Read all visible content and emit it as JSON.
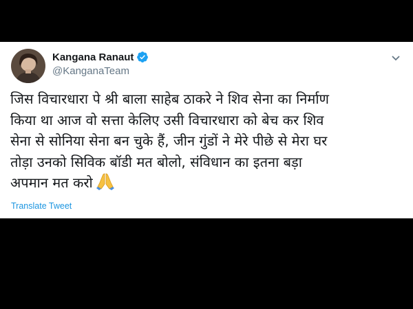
{
  "tweet": {
    "author": {
      "name": "Kangana Ranaut",
      "handle": "@KanganaTeam",
      "verified": true
    },
    "body_lines": [
      "जिस विचारधारा पे श्री बाला साहेब ठाकरे ने शिव सेना का निर्माण",
      "किया था आज वो सत्ता केलिए उसी विचारधारा को बेच कर शिव",
      "सेना से सोनिया सेना बन चुके हैं, जीन गुंडों ने मेरे पीछे से मेरा घर",
      "तोड़ा उनको सिविक बॉडी मत बोलो, संविधान का इतना बड़ा",
      "अपमान मत करो"
    ],
    "translate_label": "Translate Tweet",
    "icons": {
      "verified": "verified-badge-icon",
      "menu": "chevron-down-icon",
      "emoji": "folded-hands-icon"
    },
    "colors": {
      "accent": "#1da1f2",
      "link": "#1b95e0",
      "text": "#14171a",
      "muted": "#657786",
      "background": "#000000"
    }
  }
}
